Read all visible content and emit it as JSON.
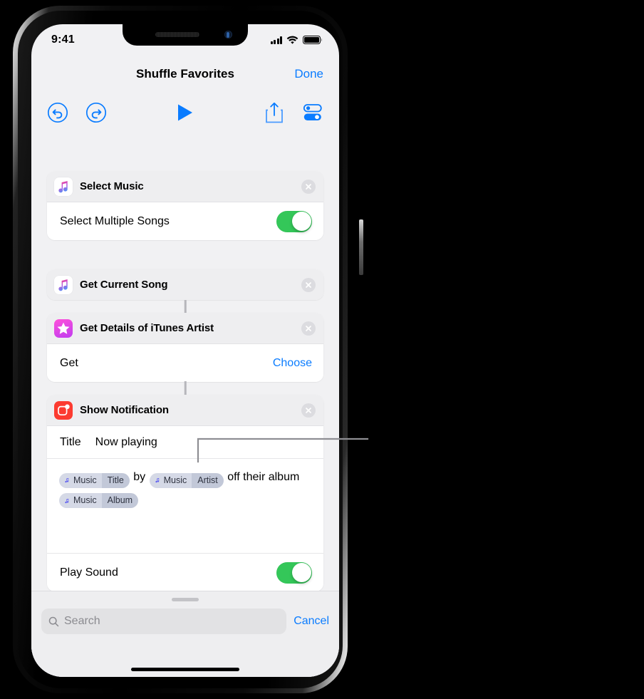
{
  "device": {
    "status_bar": {
      "clock": "9:41",
      "cellular_icon": "signal-bars-icon",
      "wifi_icon": "wifi-icon",
      "battery_icon": "battery-full-icon"
    },
    "home_indicator": "home-indicator"
  },
  "nav": {
    "title": "Shuffle Favorites",
    "done_label": "Done"
  },
  "toolbar": {
    "undo_icon": "undo-icon",
    "redo_icon": "redo-icon",
    "play_icon": "play-icon",
    "share_icon": "share-icon",
    "settings_icon": "settings-sliders-icon"
  },
  "actions": [
    {
      "id": "select-music",
      "title": "Select Music",
      "icon": "apple-music-icon",
      "close_icon": "close-icon",
      "rows": [
        {
          "type": "toggle",
          "label": "Select Multiple Songs",
          "value": "on"
        }
      ]
    },
    {
      "id": "get-current-song",
      "title": "Get Current Song",
      "icon": "apple-music-icon",
      "close_icon": "close-icon",
      "rows": []
    },
    {
      "id": "get-details-of-itunes-artist",
      "title": "Get Details of iTunes Artist",
      "icon": "itunes-star-icon",
      "close_icon": "close-icon",
      "rows": [
        {
          "type": "link",
          "label": "Get",
          "link_label": "Choose"
        }
      ]
    },
    {
      "id": "show-notification",
      "title": "Show Notification",
      "icon": "notification-badge-icon",
      "close_icon": "close-icon",
      "title_field": {
        "label": "Title",
        "value": "Now playing"
      },
      "body_segments": [
        {
          "type": "token",
          "app": "Music",
          "property": "Title"
        },
        {
          "type": "text",
          "text": " by "
        },
        {
          "type": "token",
          "app": "Music",
          "property": "Artist"
        },
        {
          "type": "text",
          "text": " off their album "
        },
        {
          "type": "token",
          "app": "Music",
          "property": "Album"
        }
      ],
      "play_sound": {
        "label": "Play Sound",
        "value": "on"
      }
    }
  ],
  "search": {
    "placeholder": "Search",
    "value": "",
    "search_icon": "search-icon",
    "cancel_label": "Cancel"
  },
  "callout": {
    "target": "music-artist-token",
    "label": ""
  },
  "colors": {
    "accent_blue": "#0a7cff",
    "toggle_green": "#34c759",
    "notification_red": "#fc3b30",
    "token_app_bg": "#d5d9e6",
    "token_prop_bg": "#c2c8d8",
    "screen_bg": "#f1f1f3",
    "card_bg": "#ffffff",
    "callout_line": "#8e8e93"
  }
}
